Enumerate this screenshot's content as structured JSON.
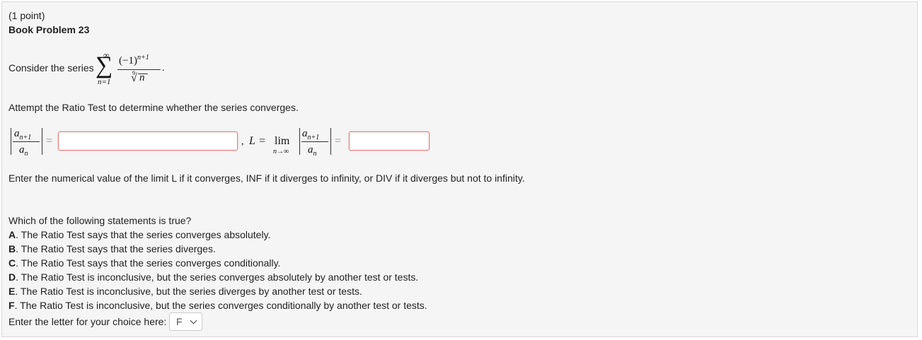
{
  "problem": {
    "points": "(1 point)",
    "title": "Book Problem 23",
    "intro": "Consider the series",
    "series": {
      "sigma": "∑",
      "upper": "∞",
      "lower": "n=1",
      "numerator": "(−1)",
      "numerator_exp": "n+1",
      "denominator_root_index": "9",
      "denominator": "n",
      "period": "."
    },
    "instruction": "Attempt the Ratio Test to determine whether the series converges.",
    "ratio": {
      "num": "a",
      "num_sub": "n+1",
      "den": "a",
      "den_sub": "n",
      "equals": "=",
      "separator": ",",
      "L_label": "L",
      "lim": "lim",
      "lim_sub": "n→∞",
      "ratio_input_value": "",
      "limit_input_value": ""
    },
    "limit_instruction": "Enter the numerical value of the limit L if it converges, INF if it diverges to infinity, or DIV if it diverges but not to infinity.",
    "question": "Which of the following statements is true?",
    "options": [
      {
        "letter": "A",
        "text": ". The Ratio Test says that the series converges absolutely."
      },
      {
        "letter": "B",
        "text": ". The Ratio Test says that the series diverges."
      },
      {
        "letter": "C",
        "text": ". The Ratio Test says that the series converges conditionally."
      },
      {
        "letter": "D",
        "text": ". The Ratio Test is inconclusive, but the series converges absolutely by another test or tests."
      },
      {
        "letter": "E",
        "text": ". The Ratio Test is inconclusive, but the series diverges by another test or tests."
      },
      {
        "letter": "F",
        "text": ". The Ratio Test is inconclusive, but the series converges conditionally by another test or tests."
      }
    ],
    "choice_prompt": "Enter the letter for your choice here:",
    "choice_selected": "F",
    "icons": {
      "select_arrow": "chevron-down-icon"
    },
    "colors": {
      "input_error_border": "#e07b7b",
      "panel_bg": "#f5f5f5"
    }
  }
}
